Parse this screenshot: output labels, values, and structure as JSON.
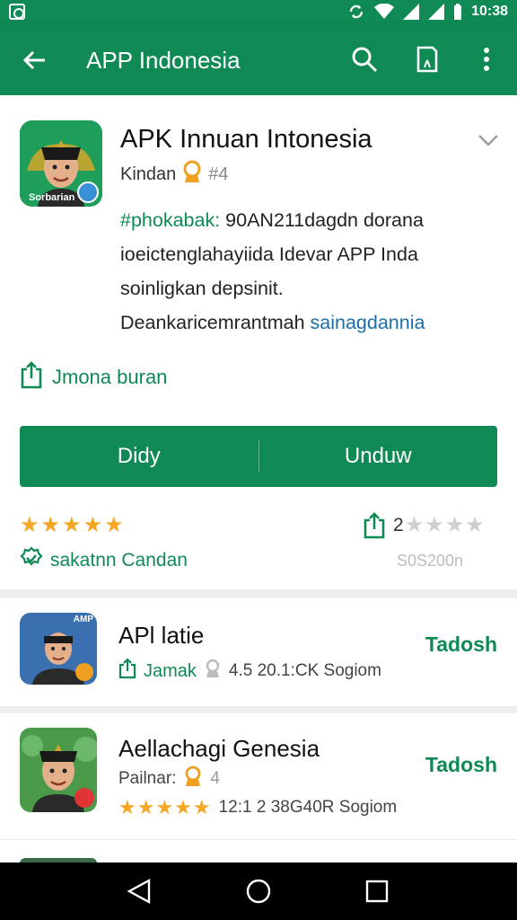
{
  "status_bar": {
    "time": "10:38"
  },
  "header": {
    "title": "APP Indonesia"
  },
  "app": {
    "title": "APK Innuan Intonesia",
    "developer": "Kindan",
    "rating_small": "#4",
    "icon_label": "Sorbarian",
    "description": {
      "hashtag": "#phokabak:",
      "line1_rest": " 90AN211dagdn dorana",
      "line2": "ioeictenglahayiida Idevar APP Inda",
      "line3": "soinligkan depsinit.",
      "line4_start": "Deankaricemrantmah ",
      "line4_link": "sainagdannia"
    },
    "share_label": "Jmona buran",
    "install_left": "Didy",
    "install_right": "Unduw",
    "saved_label": "sakatnn Candan",
    "rating_count": "2",
    "reviews": "S0S200n"
  },
  "list": [
    {
      "title": "APl latie",
      "meta_label": "Jamak",
      "meta_text": "4.5 20.1:CK Sogiom",
      "action": "Tadosh",
      "icon_tag": "AMP"
    },
    {
      "title": "Aellachagi Genesia",
      "developer": "Pailnar:",
      "rating": "4",
      "meta_text": "12:1 2 38G40R Sogiom",
      "action": "Tadosh"
    }
  ],
  "colors": {
    "primary": "#0f8a55",
    "star": "#f5a623"
  }
}
